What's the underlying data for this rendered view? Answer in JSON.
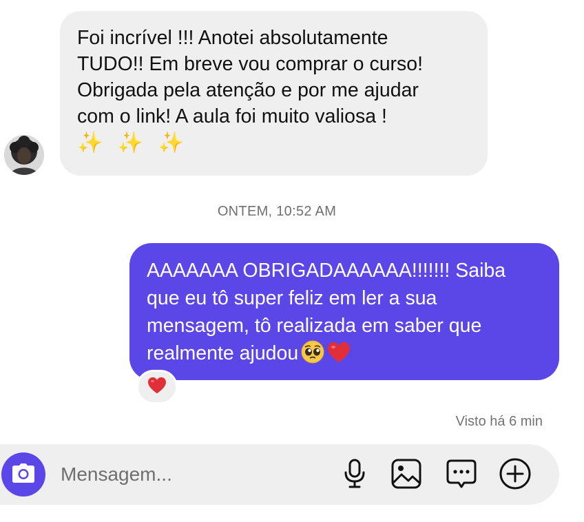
{
  "conversation": {
    "incoming_message": {
      "lines": [
        "Foi incrível !!! Anotei absolutamente",
        "TUDO!! Em breve vou comprar o curso!",
        "Obrigada pela atenção e por me ajudar",
        "com o link! A aula foi muito valiosa !"
      ],
      "emoji_line": "✨ ✨ ✨"
    },
    "timestamp": "ONTEM, 10:52 AM",
    "outgoing_message": {
      "lines": [
        "AAAAAAA OBRIGADAAAAAA!!!!!!! Saiba",
        "que eu tô super feliz em ler a sua",
        "mensagem, tô realizada em saber que",
        "realmente ajudou"
      ],
      "emojis": [
        "pleading-face-emoji",
        "red-heart-emoji"
      ]
    },
    "reaction": "red-heart-emoji",
    "seen_status": "Visto há 6 min"
  },
  "composer": {
    "placeholder": "Mensagem...",
    "value": "",
    "icons": [
      "camera-icon",
      "microphone-icon",
      "gallery-icon",
      "sticker-chat-icon",
      "add-circle-icon"
    ]
  },
  "colors": {
    "outgoing_bubble": "#5b46e8",
    "incoming_bubble": "#efefef",
    "camera_button": "#5b46e8",
    "heart": "#e02f38"
  }
}
